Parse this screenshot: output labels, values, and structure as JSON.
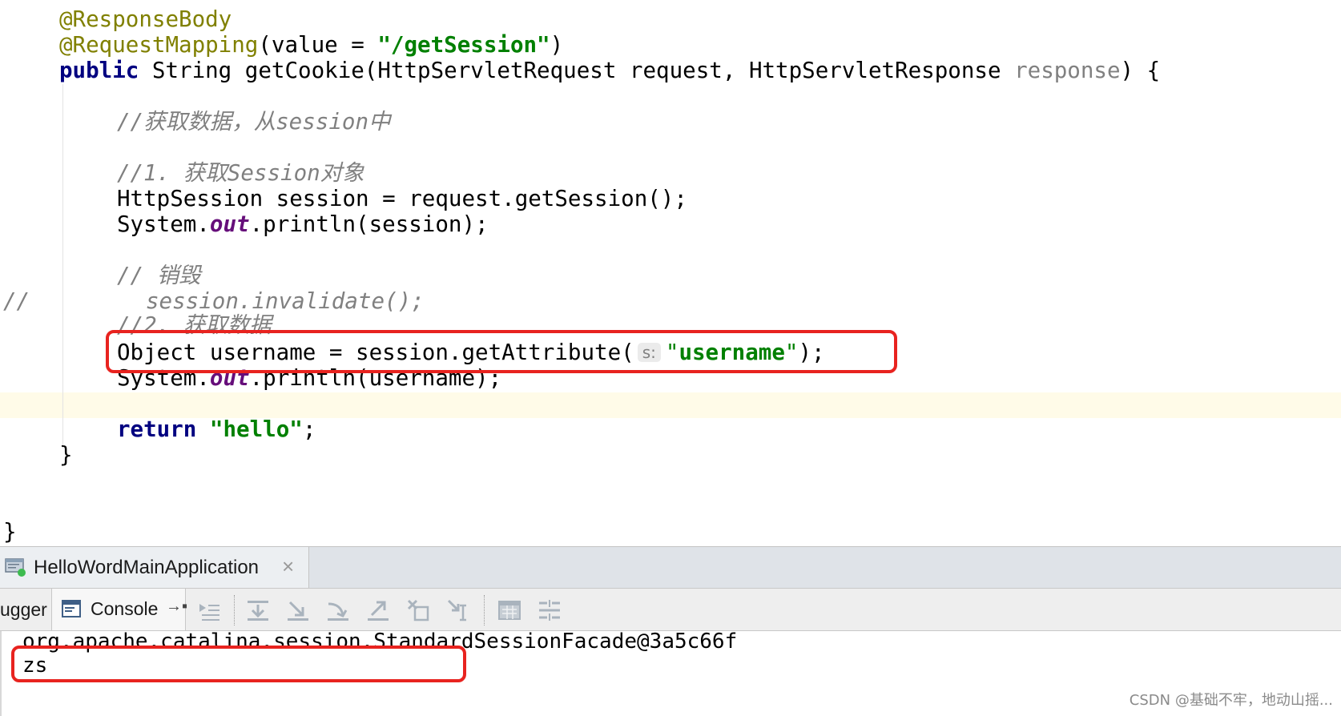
{
  "editor": {
    "annotation_response_body": "@ResponseBody",
    "annotation_request_mapping": "@RequestMapping",
    "mapping_open": "(value = ",
    "mapping_value": "\"/getSession\"",
    "mapping_close": ")",
    "kw_public": "public",
    "sig_mid": " String getCookie(HttpServletRequest request, HttpServletResponse ",
    "sig_param_unused": "response",
    "sig_end": ") {",
    "comment_get_data": "//获取数据，从session中",
    "comment_step1": "//1. 获取Session对象",
    "line_get_session": "HttpSession session = request.getSession();",
    "sys_prefix": "System.",
    "sys_out": "out",
    "println_session": ".println(session);",
    "comment_destroy": "// 销毁",
    "commented_marker": "//",
    "commented_invalidate": "session.invalidate();",
    "comment_step2": "//2. 获取数据",
    "line_object_prefix": "Object username = session.getAttribute(",
    "param_hint": "s:",
    "attr_quote_open": "\"",
    "attr_name": "username",
    "attr_quote_close": "\"",
    "line_object_suffix": ");",
    "println_username": ".println(username);",
    "kw_return": "return",
    "return_value": "\"hello\"",
    "return_suffix": ";",
    "method_close": "}",
    "class_close": "}"
  },
  "run_panel": {
    "tab_label": "HelloWordMainApplication",
    "tab_close": "×",
    "debugger_label": "ugger",
    "console_label": "Console",
    "console_pin": "→▪"
  },
  "console": {
    "line1": "org.apache.catalina.session.StandardSessionFacade@3a5c66f",
    "line2": "zs"
  },
  "watermark": "CSDN @基础不牢，地动山摇...",
  "colors": {
    "highlight_box": "#e8231f",
    "caret_row": "#fffbe8",
    "string": "#008000",
    "keyword": "#000080",
    "annotation": "#808000",
    "static_field": "#660e7a",
    "comment": "#808080"
  }
}
